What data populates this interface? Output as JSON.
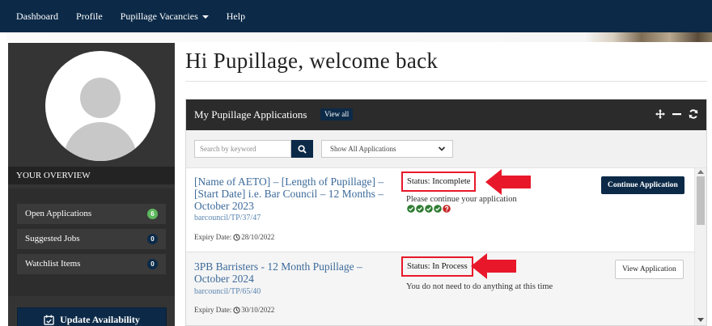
{
  "nav": {
    "items": [
      {
        "label": "Dashboard"
      },
      {
        "label": "Profile"
      },
      {
        "label": "Pupillage Vacancies",
        "has_dropdown": true
      },
      {
        "label": "Help"
      }
    ]
  },
  "page": {
    "title": "Hi Pupillage, welcome back"
  },
  "sidebar": {
    "overview_title": "YOUR OVERVIEW",
    "items": [
      {
        "label": "Open Applications",
        "count": "6",
        "badge_color": "#5cb85c"
      },
      {
        "label": "Suggested Jobs",
        "count": "0",
        "badge_color": "#0c2a48"
      },
      {
        "label": "Watchlist Items",
        "count": "0",
        "badge_color": "#0c2a48"
      }
    ],
    "update_button": "Update Availability"
  },
  "applications_panel": {
    "title": "My Pupillage Applications",
    "view_all": "View all",
    "search_placeholder": "Search by keyword",
    "filter_selected": "Show All Applications",
    "tools": [
      "move-icon",
      "minimize-icon",
      "refresh-icon"
    ],
    "rows": [
      {
        "title": "[Name of AETO] – [Length of Pupillage] – [Start Date] i.e. Bar Council – 12 Months – October 2023",
        "ref": "barcouncil/TP/37/47",
        "expiry_label": "Expiry Date:",
        "expiry_date": "28/10/2022",
        "status_label": "Status:",
        "status_value": "Incomplete",
        "status_message": "Please continue your application",
        "steps": [
          "complete",
          "complete",
          "complete",
          "complete",
          "missing"
        ],
        "action_label": "Continue Application"
      },
      {
        "title": "3PB Barristers - 12 Month Pupillage – October 2024",
        "ref": "barcouncil/TP/65/40",
        "expiry_label": "Expiry Date:",
        "expiry_date": "30/10/2022",
        "status_label": "Status:",
        "status_value": "In Process",
        "status_message": "You do not need to do anything at this time",
        "action_label": "View Application"
      }
    ]
  },
  "colors": {
    "navy": "#0c2a48",
    "dark_panel": "#2b2b2b",
    "link_blue": "#3c6a9a",
    "annotation_red": "#e8182a",
    "success_green": "#2e7d32",
    "error_red": "#c62828"
  }
}
